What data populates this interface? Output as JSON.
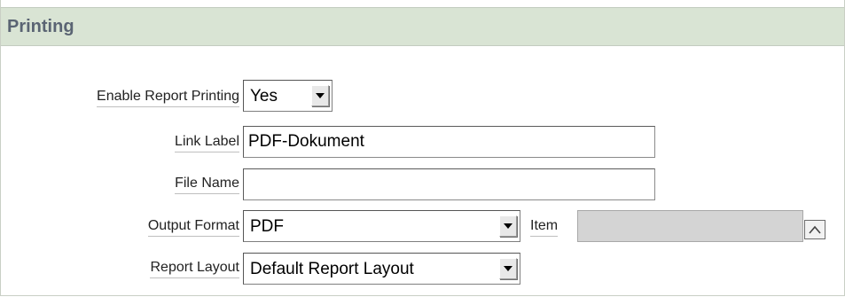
{
  "section": {
    "title": "Printing"
  },
  "fields": {
    "enable_printing": {
      "label": "Enable Report Printing",
      "value": "Yes"
    },
    "link_label": {
      "label": "Link Label",
      "value": "PDF-Dokument"
    },
    "file_name": {
      "label": "File Name",
      "value": ""
    },
    "output_format": {
      "label": "Output Format",
      "value": "PDF"
    },
    "item": {
      "label": "Item",
      "value": ""
    },
    "report_layout": {
      "label": "Report Layout",
      "value": "Default Report Layout"
    }
  },
  "icons": {
    "select_arrow": "chevron-down-icon",
    "item_popup": "chevron-up-icon"
  },
  "colors": {
    "header_bg": "#d9e4d4",
    "header_text": "#5a6473",
    "disabled_input_bg": "#d4d4d4"
  }
}
